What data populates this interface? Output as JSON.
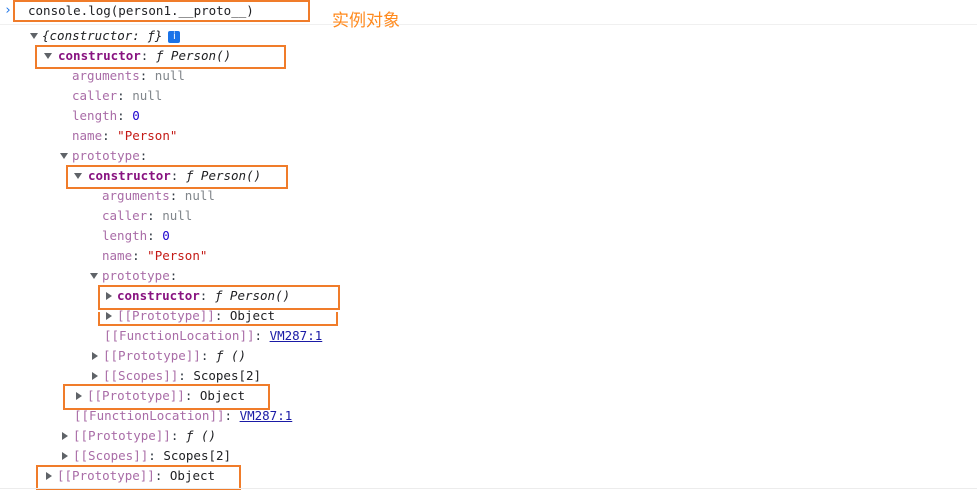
{
  "command": {
    "icon": "chevron-right-icon",
    "text": "console.log(person1.__proto__)"
  },
  "annotation": "实例对象",
  "colors": {
    "highlight_box": "#f07c2a",
    "annotation": "#ff8a1e",
    "key": "#881280",
    "string": "#c41a16",
    "number": "#1c00cf",
    "link": "#1a1aa6"
  },
  "tree": {
    "root_label": "{constructor: ƒ}",
    "info_badge": "i",
    "constructor": {
      "key": "constructor",
      "fn_prefix": "ƒ",
      "value": "Person()",
      "props": [
        {
          "key": "arguments",
          "value": "null"
        },
        {
          "key": "caller",
          "value": "null"
        },
        {
          "key": "length",
          "value": "0"
        },
        {
          "key": "name",
          "value": "\"Person\""
        }
      ],
      "prototype": {
        "key": "prototype",
        "constructor": {
          "key": "constructor",
          "fn_prefix": "ƒ",
          "value": "Person()",
          "props": [
            {
              "key": "arguments",
              "value": "null"
            },
            {
              "key": "caller",
              "value": "null"
            },
            {
              "key": "length",
              "value": "0"
            },
            {
              "key": "name",
              "value": "\"Person\""
            }
          ],
          "prototype": {
            "key": "prototype",
            "constructor": {
              "key": "constructor",
              "fn_prefix": "ƒ",
              "value": "Person()"
            },
            "proto": {
              "key": "[[Prototype]]",
              "value": "Object"
            }
          },
          "function_location": {
            "key": "[[FunctionLocation]]",
            "link": "VM287:1"
          },
          "proto": {
            "key": "[[Prototype]]",
            "fn_prefix": "ƒ",
            "value": "()"
          },
          "scopes": {
            "key": "[[Scopes]]",
            "value": "Scopes[2]"
          }
        },
        "proto": {
          "key": "[[Prototype]]",
          "value": "Object"
        }
      },
      "function_location": {
        "key": "[[FunctionLocation]]",
        "link": "VM287:1"
      },
      "proto": {
        "key": "[[Prototype]]",
        "fn_prefix": "ƒ",
        "value": "()"
      },
      "scopes": {
        "key": "[[Scopes]]",
        "value": "Scopes[2]"
      }
    },
    "root_proto": {
      "key": "[[Prototype]]",
      "value": "Object"
    }
  }
}
